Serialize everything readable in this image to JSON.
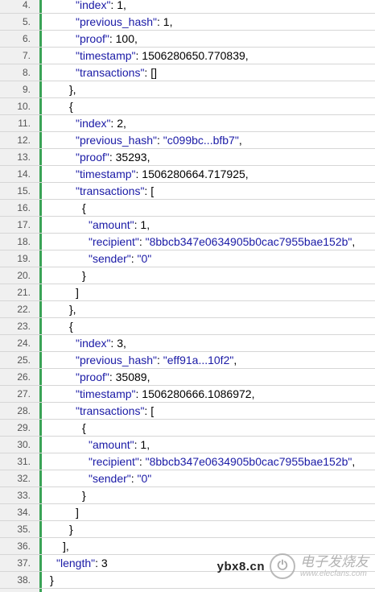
{
  "lines": [
    {
      "n": "4.",
      "i": 5,
      "t": [
        [
          "k",
          "\"index\""
        ],
        [
          "p",
          ": "
        ],
        [
          "n",
          "1"
        ],
        [
          "p",
          ","
        ]
      ]
    },
    {
      "n": "5.",
      "i": 5,
      "t": [
        [
          "k",
          "\"previous_hash\""
        ],
        [
          "p",
          ": "
        ],
        [
          "n",
          "1"
        ],
        [
          "p",
          ","
        ]
      ]
    },
    {
      "n": "6.",
      "i": 5,
      "t": [
        [
          "k",
          "\"proof\""
        ],
        [
          "p",
          ": "
        ],
        [
          "n",
          "100"
        ],
        [
          "p",
          ","
        ]
      ]
    },
    {
      "n": "7.",
      "i": 5,
      "t": [
        [
          "k",
          "\"timestamp\""
        ],
        [
          "p",
          ": "
        ],
        [
          "n",
          "1506280650.770839"
        ],
        [
          "p",
          ","
        ]
      ]
    },
    {
      "n": "8.",
      "i": 5,
      "t": [
        [
          "k",
          "\"transactions\""
        ],
        [
          "p",
          ": "
        ],
        [
          "p",
          "[]"
        ]
      ]
    },
    {
      "n": "9.",
      "i": 4,
      "t": [
        [
          "p",
          "},"
        ]
      ]
    },
    {
      "n": "10.",
      "i": 4,
      "t": [
        [
          "p",
          "{"
        ]
      ]
    },
    {
      "n": "11.",
      "i": 5,
      "t": [
        [
          "k",
          "\"index\""
        ],
        [
          "p",
          ": "
        ],
        [
          "n",
          "2"
        ],
        [
          "p",
          ","
        ]
      ]
    },
    {
      "n": "12.",
      "i": 5,
      "t": [
        [
          "k",
          "\"previous_hash\""
        ],
        [
          "p",
          ": "
        ],
        [
          "s",
          "\"c099bc...bfb7\""
        ],
        [
          "p",
          ","
        ]
      ]
    },
    {
      "n": "13.",
      "i": 5,
      "t": [
        [
          "k",
          "\"proof\""
        ],
        [
          "p",
          ": "
        ],
        [
          "n",
          "35293"
        ],
        [
          "p",
          ","
        ]
      ]
    },
    {
      "n": "14.",
      "i": 5,
      "t": [
        [
          "k",
          "\"timestamp\""
        ],
        [
          "p",
          ": "
        ],
        [
          "n",
          "1506280664.717925"
        ],
        [
          "p",
          ","
        ]
      ]
    },
    {
      "n": "15.",
      "i": 5,
      "t": [
        [
          "k",
          "\"transactions\""
        ],
        [
          "p",
          ": ["
        ]
      ]
    },
    {
      "n": "16.",
      "i": 6,
      "t": [
        [
          "p",
          "{"
        ]
      ]
    },
    {
      "n": "17.",
      "i": 7,
      "t": [
        [
          "k",
          "\"amount\""
        ],
        [
          "p",
          ": "
        ],
        [
          "n",
          "1"
        ],
        [
          "p",
          ","
        ]
      ]
    },
    {
      "n": "18.",
      "i": 7,
      "t": [
        [
          "k",
          "\"recipient\""
        ],
        [
          "p",
          ": "
        ],
        [
          "s",
          "\"8bbcb347e0634905b0cac7955bae152b\""
        ],
        [
          "p",
          ","
        ]
      ]
    },
    {
      "n": "19.",
      "i": 7,
      "t": [
        [
          "k",
          "\"sender\""
        ],
        [
          "p",
          ": "
        ],
        [
          "s",
          "\"0\""
        ]
      ]
    },
    {
      "n": "20.",
      "i": 6,
      "t": [
        [
          "p",
          "}"
        ]
      ]
    },
    {
      "n": "21.",
      "i": 5,
      "t": [
        [
          "p",
          "]"
        ]
      ]
    },
    {
      "n": "22.",
      "i": 4,
      "t": [
        [
          "p",
          "},"
        ]
      ]
    },
    {
      "n": "23.",
      "i": 4,
      "t": [
        [
          "p",
          "{"
        ]
      ]
    },
    {
      "n": "24.",
      "i": 5,
      "t": [
        [
          "k",
          "\"index\""
        ],
        [
          "p",
          ": "
        ],
        [
          "n",
          "3"
        ],
        [
          "p",
          ","
        ]
      ]
    },
    {
      "n": "25.",
      "i": 5,
      "t": [
        [
          "k",
          "\"previous_hash\""
        ],
        [
          "p",
          ": "
        ],
        [
          "s",
          "\"eff91a...10f2\""
        ],
        [
          "p",
          ","
        ]
      ]
    },
    {
      "n": "26.",
      "i": 5,
      "t": [
        [
          "k",
          "\"proof\""
        ],
        [
          "p",
          ": "
        ],
        [
          "n",
          "35089"
        ],
        [
          "p",
          ","
        ]
      ]
    },
    {
      "n": "27.",
      "i": 5,
      "t": [
        [
          "k",
          "\"timestamp\""
        ],
        [
          "p",
          ": "
        ],
        [
          "n",
          "1506280666.1086972"
        ],
        [
          "p",
          ","
        ]
      ]
    },
    {
      "n": "28.",
      "i": 5,
      "t": [
        [
          "k",
          "\"transactions\""
        ],
        [
          "p",
          ": ["
        ]
      ]
    },
    {
      "n": "29.",
      "i": 6,
      "t": [
        [
          "p",
          "{"
        ]
      ]
    },
    {
      "n": "30.",
      "i": 7,
      "t": [
        [
          "k",
          "\"amount\""
        ],
        [
          "p",
          ": "
        ],
        [
          "n",
          "1"
        ],
        [
          "p",
          ","
        ]
      ]
    },
    {
      "n": "31.",
      "i": 7,
      "t": [
        [
          "k",
          "\"recipient\""
        ],
        [
          "p",
          ": "
        ],
        [
          "s",
          "\"8bbcb347e0634905b0cac7955bae152b\""
        ],
        [
          "p",
          ","
        ]
      ]
    },
    {
      "n": "32.",
      "i": 7,
      "t": [
        [
          "k",
          "\"sender\""
        ],
        [
          "p",
          ": "
        ],
        [
          "s",
          "\"0\""
        ]
      ]
    },
    {
      "n": "33.",
      "i": 6,
      "t": [
        [
          "p",
          "}"
        ]
      ]
    },
    {
      "n": "34.",
      "i": 5,
      "t": [
        [
          "p",
          "]"
        ]
      ]
    },
    {
      "n": "35.",
      "i": 4,
      "t": [
        [
          "p",
          "}"
        ]
      ]
    },
    {
      "n": "36.",
      "i": 3,
      "t": [
        [
          "p",
          "],"
        ]
      ]
    },
    {
      "n": "37.",
      "i": 2,
      "t": [
        [
          "k",
          "\"length\""
        ],
        [
          "p",
          ": "
        ],
        [
          "n",
          "3"
        ]
      ]
    },
    {
      "n": "38.",
      "i": 1,
      "t": [
        [
          "p",
          "}"
        ]
      ]
    }
  ],
  "watermark": {
    "site": "ybx8.cn",
    "brand_cn": "电子发烧友",
    "brand_url": "www.elecfans.com"
  },
  "colors": {
    "key": "#1a1aa6",
    "string": "#1a1aa6",
    "gutter_border": "#3aa356",
    "gutter_bg": "#f0f0f0"
  }
}
